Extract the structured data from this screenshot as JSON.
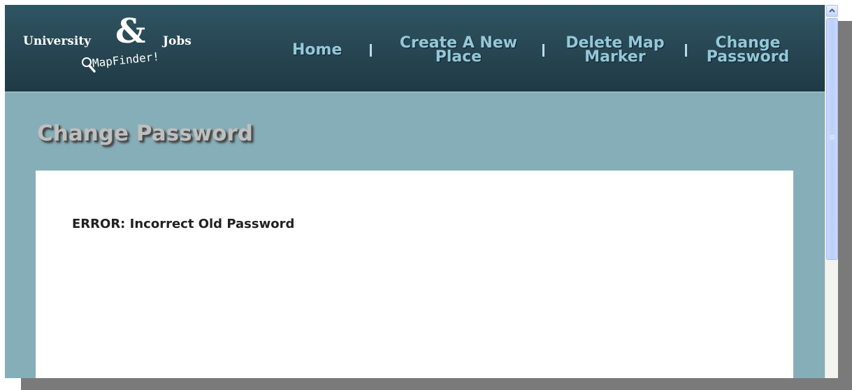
{
  "logo": {
    "university": "University",
    "ampersand": "&",
    "jobs": "Jobs",
    "mapfinder": "MapFinder!"
  },
  "nav": {
    "home": "Home",
    "create_line1": "Create A New",
    "create_line2": "Place",
    "delete_line1": "Delete Map",
    "delete_line2": "Marker",
    "change_line1": "Change",
    "change_line2": "Password",
    "separator": "|"
  },
  "page": {
    "title": "Change Password",
    "error_message": "ERROR: Incorrect Old Password"
  },
  "colors": {
    "header_bg": "#274552",
    "body_bg": "#86aeb8",
    "nav_text": "#94c8d8",
    "panel_bg": "#ffffff"
  }
}
